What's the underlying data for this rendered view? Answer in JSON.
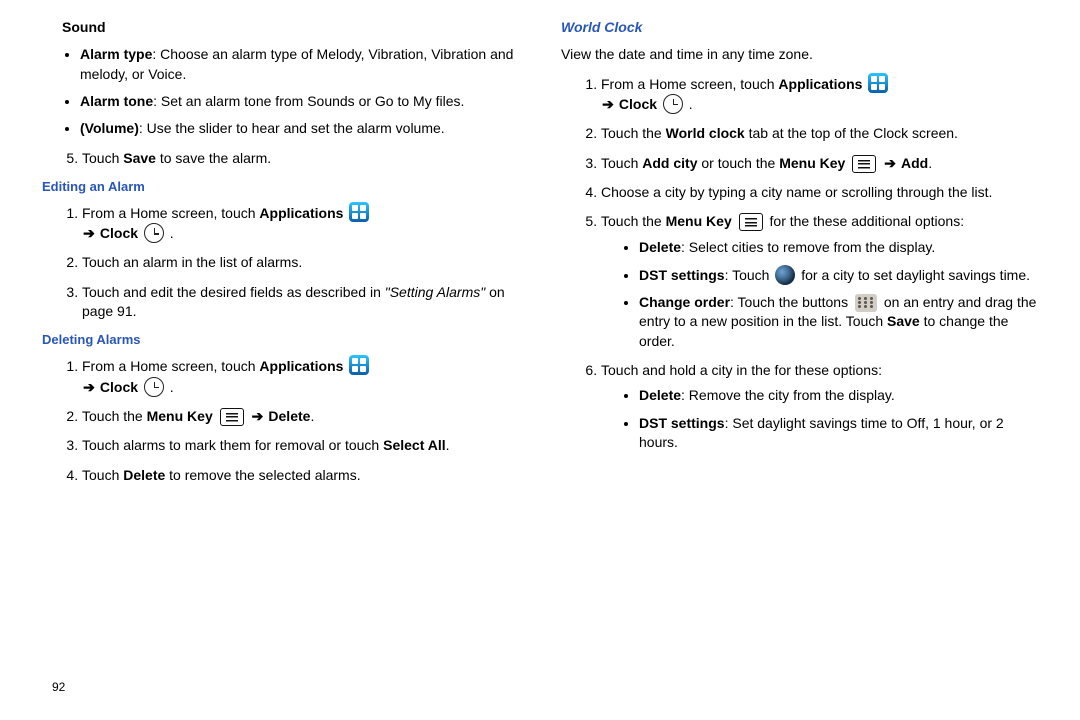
{
  "left": {
    "soundHeading": "Sound",
    "alarmTypeLabel": "Alarm type",
    "alarmTypeText": ": Choose an alarm type of Melody, Vibration, Vibration and melody, or Voice.",
    "alarmToneLabel": "Alarm tone",
    "alarmToneText": ": Set an alarm tone from Sounds or Go to My files.",
    "volumeLabel": "(Volume)",
    "volumeText": ": Use the slider to hear and set the alarm volume.",
    "step5a": "Touch ",
    "step5bold": "Save",
    "step5b": " to save the alarm.",
    "editHeading": "Editing an Alarm",
    "edit1a": "From a Home screen, touch ",
    "appsLabel": "Applications",
    "arrow": "➔",
    "clockLabel": "Clock",
    "edit2": "Touch an alarm in the list of alarms.",
    "edit3a": "Touch and edit the desired fields as described in ",
    "edit3i": "\"Setting Alarms\"",
    "edit3b": " on page 91.",
    "delHeading": "Deleting Alarms",
    "del2a": "Touch the ",
    "menuKeyLabel": "Menu Key",
    "deleteLabel": "Delete",
    "del3a": "Touch alarms to mark them for removal or touch ",
    "selectAll": "Select All",
    "del4a": "Touch ",
    "del4b": " to remove the selected alarms."
  },
  "right": {
    "wcHeading": "World Clock",
    "intro": "View the date and time in any time zone.",
    "s2a": "Touch the ",
    "worldClockTab": "World clock",
    "s2b": " tab at the top of the Clock screen.",
    "s3a": "Touch ",
    "addCity": "Add city",
    "s3b": " or touch the ",
    "addLabel": "Add",
    "s4": "Choose a city by typing a city name or scrolling through the list.",
    "s5a": "Touch the ",
    "s5b": " for the these additional options:",
    "optDelLabel": "Delete",
    "optDelText": ": Select cities to remove from the display.",
    "optDstLabel": "DST settings",
    "optDstA": ": Touch ",
    "optDstB": " for a city to set daylight savings time.",
    "optChgLabel": "Change order",
    "optChgA": ": Touch the buttons ",
    "optChgB": " on an entry and drag the entry to a new position in the list. Touch ",
    "saveLabel": "Save",
    "optChgC": " to change the order.",
    "s6": "Touch and hold a city in the for these options:",
    "hDelText": ": Remove the city from the display.",
    "hDstText": ": Set daylight savings time to Off, 1 hour, or 2 hours."
  },
  "pageNumber": "92"
}
